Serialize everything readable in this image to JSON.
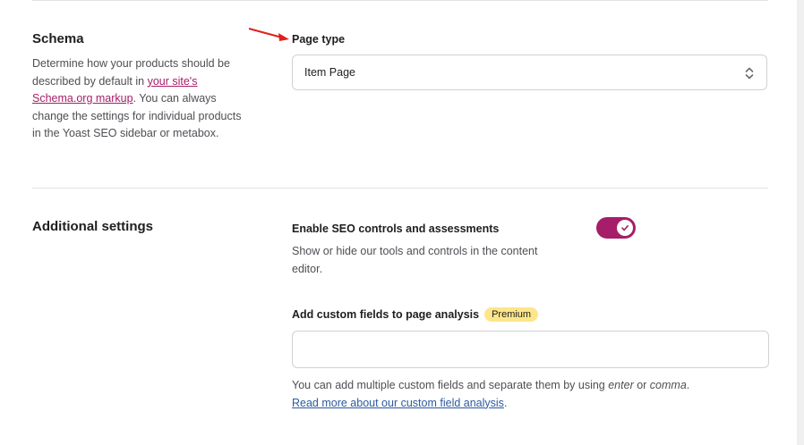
{
  "schema": {
    "title": "Schema",
    "desc_before": "Determine how your products should be described by default in ",
    "desc_link": "your site's Schema.org markup",
    "desc_after": ". You can always change the settings for individual products in the Yoast SEO sidebar or metabox.",
    "page_type_label": "Page type",
    "page_type_value": "Item Page"
  },
  "additional": {
    "title": "Additional settings",
    "seo_controls_label": "Enable SEO controls and assessments",
    "seo_controls_desc": "Show or hide our tools and controls in the content editor.",
    "seo_controls_enabled": true,
    "custom_fields_label": "Add custom fields to page analysis",
    "premium_badge": "Premium",
    "custom_fields_value": "",
    "help_before": "You can add multiple custom fields and separate them by using ",
    "help_enter": "enter",
    "help_or": " or ",
    "help_comma": "comma",
    "help_period": ".",
    "help_link": "Read more about our custom field analysis",
    "help_link_period": "."
  },
  "colors": {
    "accent": "#a61e69",
    "badge_bg": "#fde68a",
    "link_blue": "#2c5aa0",
    "arrow": "#e0201b"
  }
}
